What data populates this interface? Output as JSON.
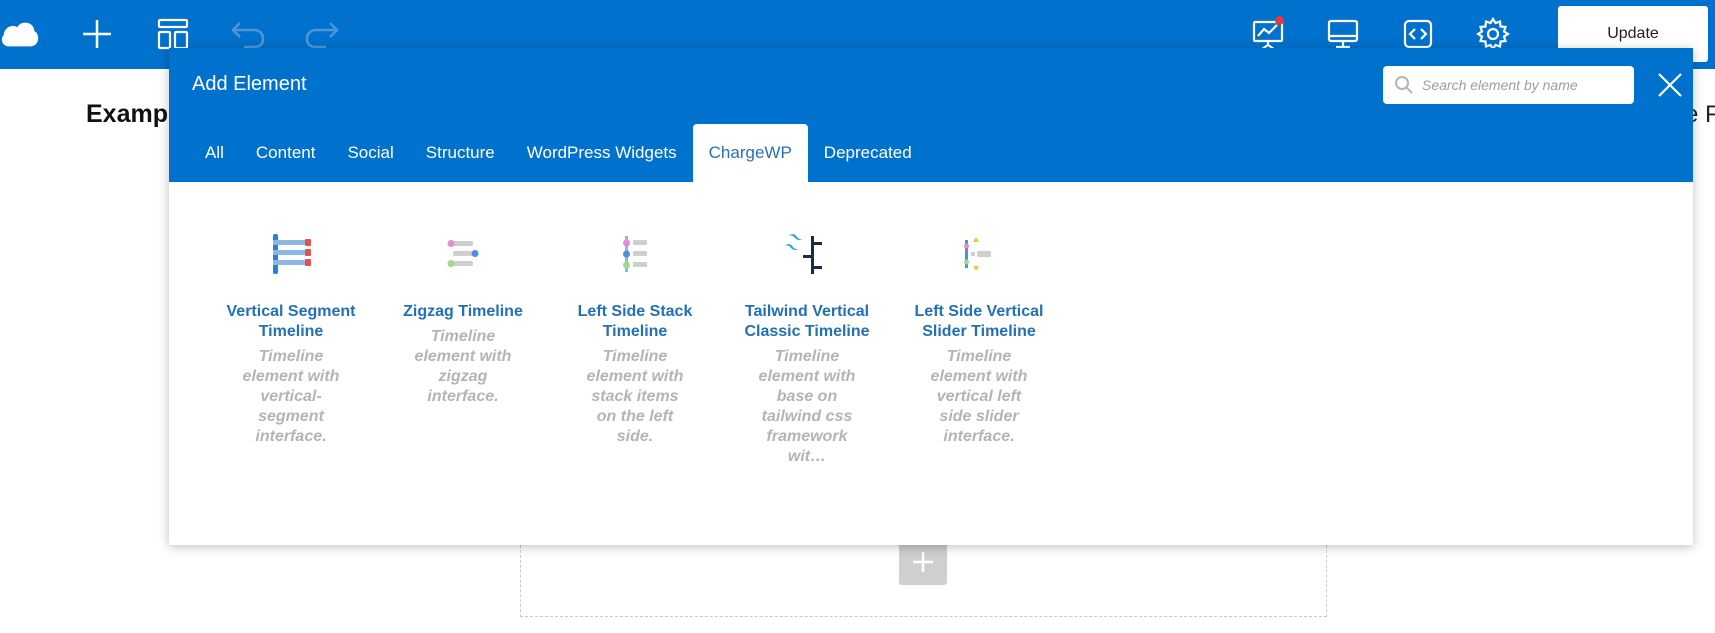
{
  "toolbar": {
    "update_label": "Update"
  },
  "page": {
    "heading": "Examp",
    "heading_right": "e F"
  },
  "modal": {
    "title": "Add Element",
    "search_placeholder": "Search element by name",
    "tabs": [
      {
        "label": "All",
        "active": false
      },
      {
        "label": "Content",
        "active": false
      },
      {
        "label": "Social",
        "active": false
      },
      {
        "label": "Structure",
        "active": false
      },
      {
        "label": "WordPress Widgets",
        "active": false
      },
      {
        "label": "ChargeWP",
        "active": true
      },
      {
        "label": "Deprecated",
        "active": false
      }
    ],
    "elements": [
      {
        "name": "Vertical Segment Timeline",
        "description": "Timeline element with vertical-segment interface.",
        "icon": "vertical-segment-timeline-icon"
      },
      {
        "name": "Zigzag Timeline",
        "description": "Timeline element with zigzag interface.",
        "icon": "zigzag-timeline-icon"
      },
      {
        "name": "Left Side Stack Timeline",
        "description": "Timeline element with stack items on the left side.",
        "icon": "left-side-stack-timeline-icon"
      },
      {
        "name": "Tailwind Vertical Classic Timeline",
        "description": "Timeline element with base on tailwind css framework wit…",
        "icon": "tailwind-vertical-classic-timeline-icon"
      },
      {
        "name": "Left Side Vertical Slider Timeline",
        "description": "Timeline element with vertical left side slider interface.",
        "icon": "left-side-vertical-slider-timeline-icon"
      }
    ]
  },
  "colors": {
    "brand_blue": "#0071cc",
    "element_title": "#2270b5",
    "element_desc": "#b4b4b4"
  }
}
